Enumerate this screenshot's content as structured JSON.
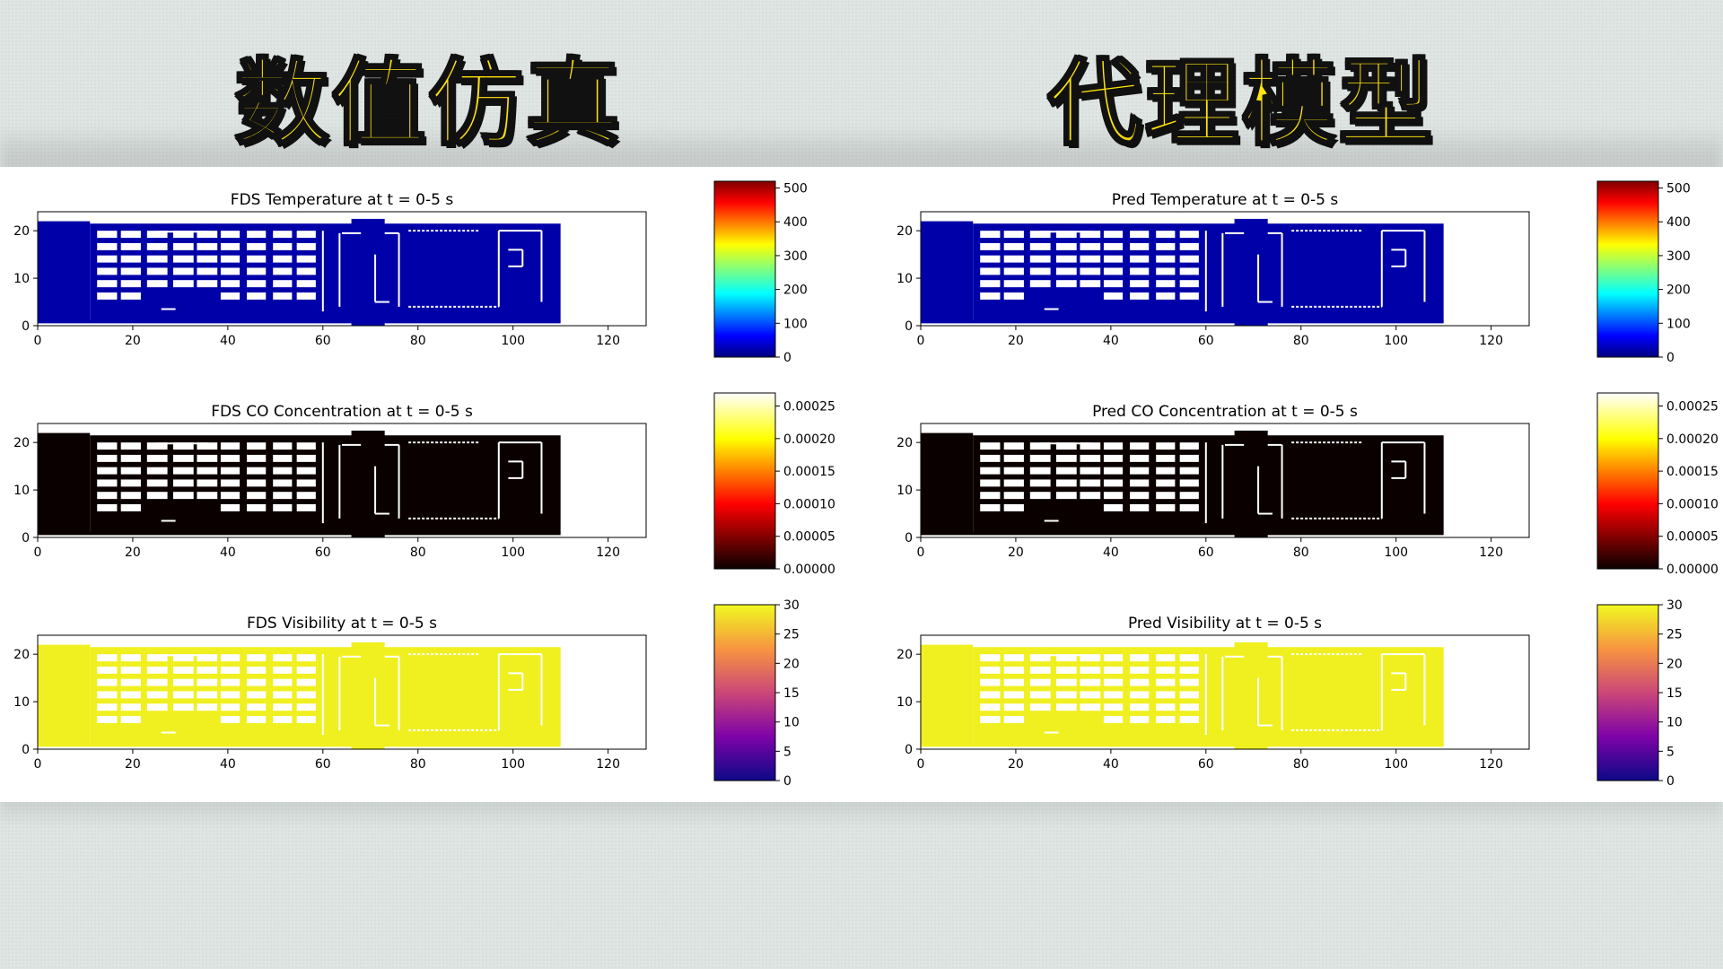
{
  "banner": {
    "left": "数值仿真",
    "right": "代理模型"
  },
  "panels": [
    {
      "title": "FDS Temperature at t = 0-5 s",
      "map": "temp",
      "cmap": "jet",
      "cticks": [
        "0",
        "100",
        "200",
        "300",
        "400",
        "500"
      ]
    },
    {
      "title": "Pred Temperature at t = 0-5 s",
      "map": "temp",
      "cmap": "jet",
      "cticks": [
        "0",
        "100",
        "200",
        "300",
        "400",
        "500"
      ]
    },
    {
      "title": "FDS CO Concentration at t = 0-5 s",
      "map": "co",
      "cmap": "hot",
      "cticks": [
        "0.00000",
        "0.00005",
        "0.00010",
        "0.00015",
        "0.00020",
        "0.00025"
      ]
    },
    {
      "title": "Pred CO Concentration at t = 0-5 s",
      "map": "co",
      "cmap": "hot",
      "cticks": [
        "0.00000",
        "0.00005",
        "0.00010",
        "0.00015",
        "0.00020",
        "0.00025"
      ]
    },
    {
      "title": "FDS Visibility at t = 0-5 s",
      "map": "vis",
      "cmap": "plasma",
      "cticks": [
        "0",
        "5",
        "10",
        "15",
        "20",
        "25",
        "30"
      ]
    },
    {
      "title": "Pred Visibility at t = 0-5 s",
      "map": "vis",
      "cmap": "plasma",
      "cticks": [
        "0",
        "5",
        "10",
        "15",
        "20",
        "25",
        "30"
      ]
    }
  ],
  "xticks": [
    "0",
    "20",
    "40",
    "60",
    "80",
    "100",
    "120"
  ],
  "yticks": [
    "0",
    "10",
    "20"
  ],
  "chart_data": [
    {
      "type": "heatmap",
      "title": "FDS Temperature at t = 0-5 s",
      "xlim": [
        0,
        128
      ],
      "ylim": [
        0,
        24
      ],
      "field_value": 20,
      "color_range": [
        0,
        520
      ],
      "color": "#0000a8"
    },
    {
      "type": "heatmap",
      "title": "Pred Temperature at t = 0-5 s",
      "xlim": [
        0,
        128
      ],
      "ylim": [
        0,
        24
      ],
      "field_value": 20,
      "color_range": [
        0,
        520
      ],
      "color": "#0000a8"
    },
    {
      "type": "heatmap",
      "title": "FDS CO Concentration at t = 0-5 s",
      "xlim": [
        0,
        128
      ],
      "ylim": [
        0,
        24
      ],
      "field_value": 0.0,
      "color_range": [
        0,
        0.00027
      ],
      "color": "#0b0000"
    },
    {
      "type": "heatmap",
      "title": "Pred CO Concentration at t = 0-5 s",
      "xlim": [
        0,
        128
      ],
      "ylim": [
        0,
        24
      ],
      "field_value": 0.0,
      "color_range": [
        0,
        0.00027
      ],
      "color": "#0b0000"
    },
    {
      "type": "heatmap",
      "title": "FDS Visibility at t = 0-5 s",
      "xlim": [
        0,
        128
      ],
      "ylim": [
        0,
        24
      ],
      "field_value": 30,
      "color_range": [
        0,
        30
      ],
      "color": "#f0f021"
    },
    {
      "type": "heatmap",
      "title": "Pred Visibility at t = 0-5 s",
      "xlim": [
        0,
        128
      ],
      "ylim": [
        0,
        24
      ],
      "field_value": 30,
      "color_range": [
        0,
        30
      ],
      "color": "#f0f021"
    }
  ]
}
